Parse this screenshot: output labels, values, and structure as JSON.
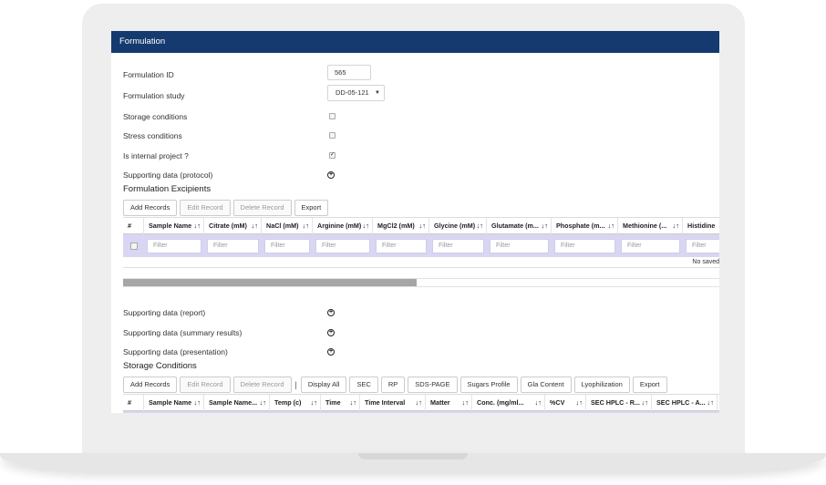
{
  "panel": {
    "title": "Formulation"
  },
  "form": {
    "formulation_id_label": "Formulation ID",
    "formulation_id_value": "565",
    "study_label": "Formulation study",
    "study_value": "DD-05-121",
    "storage_label": "Storage conditions",
    "storage_checked": false,
    "stress_label": "Stress conditions",
    "stress_checked": false,
    "internal_label": "Is internal project ?",
    "internal_checked": true,
    "protocol_label": "Supporting data (protocol)"
  },
  "excipients": {
    "title": "Formulation Excipients",
    "buttons": {
      "add": "Add Records",
      "edit": "Edit Record",
      "delete": "Delete Record",
      "export": "Export"
    },
    "columns": [
      "#",
      "Sample Name",
      "Citrate (mM)",
      "NaCl (mM)",
      "Arginine (mM)",
      "MgCl2 (mM)",
      "Glycine (mM)",
      "Glutamate (m...",
      "Phosphate (m...",
      "Methionine (...",
      "Histidine"
    ],
    "filter_placeholder": "Filter",
    "empty_text": "No saved"
  },
  "supporting": {
    "report": "Supporting data (report)",
    "summary": "Supporting data (summary results)",
    "presentation": "Supporting data (presentation)"
  },
  "storage": {
    "title": "Storage Conditions",
    "buttons": {
      "add": "Add Records",
      "edit": "Edit Record",
      "delete": "Delete Record",
      "separator": "|",
      "display_all": "Display All",
      "sec": "SEC",
      "rp": "RP",
      "sds_page": "SDS-PAGE",
      "sugars": "Sugars Profile",
      "gla": "Gla Content",
      "lyo": "Lyophilization",
      "export": "Export"
    },
    "columns": [
      "#",
      "Sample Name",
      "Sample Name...",
      "Temp (c)",
      "Time",
      "Time Interval",
      "Matter",
      "Conc. (mg/ml...",
      "%CV",
      "SEC HPLC - R...",
      "SEC HPLC - A..."
    ]
  },
  "icons": {
    "sort": "sort-icon",
    "expand": "plus-circle-icon",
    "dropdown": "caret-down-icon"
  },
  "colors": {
    "titlebar": "#143a6f",
    "filter_row": "#d8d6f2"
  }
}
